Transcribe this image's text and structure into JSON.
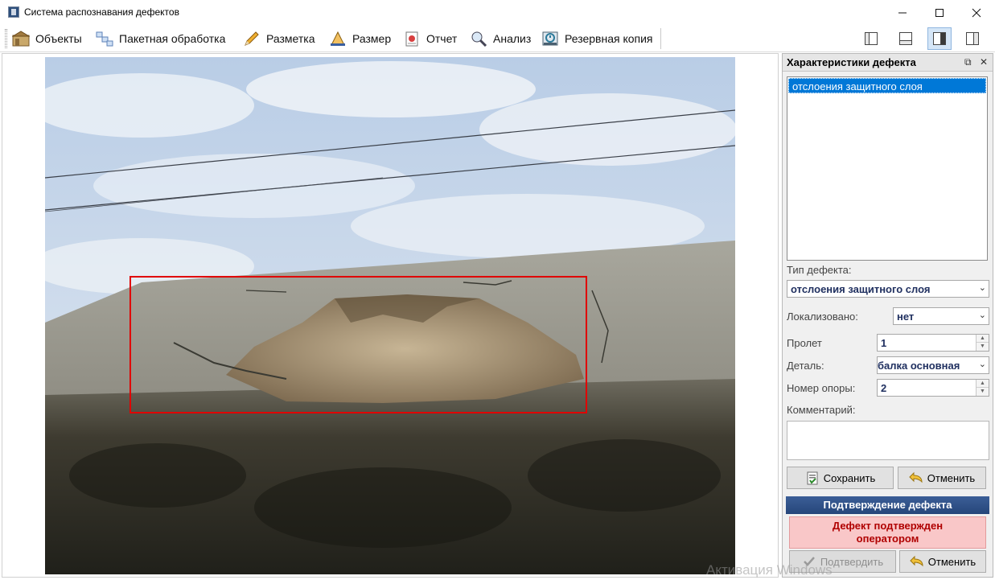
{
  "window": {
    "title": "Система распознавания дефектов",
    "minimize": "—",
    "maximize": "☐",
    "close": "✕"
  },
  "toolbar": {
    "items": [
      {
        "label": "Объекты",
        "icon": "objects-icon"
      },
      {
        "label": "Пакетная обработка",
        "icon": "batch-icon"
      },
      {
        "label": "Разметка",
        "icon": "pencil-icon"
      },
      {
        "label": "Размер",
        "icon": "size-icon"
      },
      {
        "label": "Отчет",
        "icon": "report-icon"
      },
      {
        "label": "Анализ",
        "icon": "magnifier-icon"
      },
      {
        "label": "Резервная копия",
        "icon": "backup-icon"
      }
    ],
    "layout_buttons": [
      "layout-left",
      "layout-bottom",
      "layout-right-active",
      "layout-right"
    ]
  },
  "panel": {
    "title": "Характеристики дефекта",
    "float_icon": "⧉",
    "close_icon": "✕",
    "list_items": [
      "отслоения защитного слоя"
    ],
    "defect_type_label": "Тип дефекта:",
    "defect_type_value": "отслоения защитного слоя",
    "localized_label": "Локализовано:",
    "localized_value": "нет",
    "span_label": "Пролет",
    "span_value": "1",
    "detail_label": "Деталь:",
    "detail_value": "балка основная",
    "support_label": "Номер опоры:",
    "support_value": "2",
    "comment_label": "Комментарий:",
    "save_label": "Сохранить",
    "cancel_label": "Отменить",
    "confirm_title": "Подтверждение дефекта",
    "confirm_status_line1": "Дефект подтвержден",
    "confirm_status_line2": "оператором",
    "confirm_button": "Подтвердить",
    "confirm_cancel": "Отменить"
  },
  "watermark": "Активация Windows",
  "colors": {
    "accent": "#0078d7",
    "bbox": "#e00000",
    "confirm_header": "#2f528a",
    "confirm_status_bg": "#f9c7c8",
    "confirm_status_text": "#b00000"
  }
}
